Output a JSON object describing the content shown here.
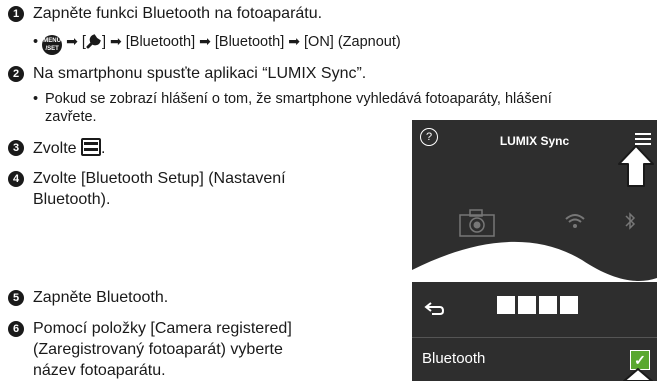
{
  "steps": [
    {
      "num": "1",
      "text": "Zapněte funkci Bluetooth na fotoaparátu."
    },
    {
      "num": "2",
      "text": "Na smartphonu spusťte aplikaci “LUMIX Sync”."
    },
    {
      "num": "3",
      "text": "Zvolte"
    },
    {
      "num": "4",
      "line1": "Zvolte [Bluetooth Setup] (Nastavení",
      "line2": "Bluetooth)."
    },
    {
      "num": "5",
      "text": "Zapněte Bluetooth."
    },
    {
      "num": "6",
      "line1": "Pomocí položky [Camera registered]",
      "line2": "(Zaregistrovaný fotoaparát) vyberte",
      "line3": "název fotoaparátu."
    }
  ],
  "step1_sub": {
    "bullet": "•",
    "menu_icon_top": "MENU",
    "menu_icon_bottom": "/SET",
    "arrow": "➡",
    "open_bracket": "[",
    "close_bracket": "]",
    "item1": "[Bluetooth]",
    "item2": "[Bluetooth]",
    "item3": "[ON] (Zapnout)"
  },
  "step2_sub": {
    "bullet": "•",
    "line1": "Pokud se zobrazí hlášení o tom, že smartphone vyhledává fotoaparáty, hlášení",
    "line2": "zavřete."
  },
  "step3_end": ".",
  "phone1": {
    "title": "LUMIX Sync",
    "help_symbol": "?"
  },
  "phone2": {
    "label": "Bluetooth",
    "check_symbol": "✓"
  },
  "colors": {
    "phone_bg": "#2e2e2e",
    "dark": "#1a1a1a",
    "check": "#5aa830"
  },
  "icons": [
    "menu-set-icon",
    "wrench-icon",
    "hamburger-icon",
    "camera-icon",
    "wifi-icon",
    "bluetooth-icon",
    "back-icon",
    "checkbox-icon",
    "arrow-up-icon"
  ]
}
